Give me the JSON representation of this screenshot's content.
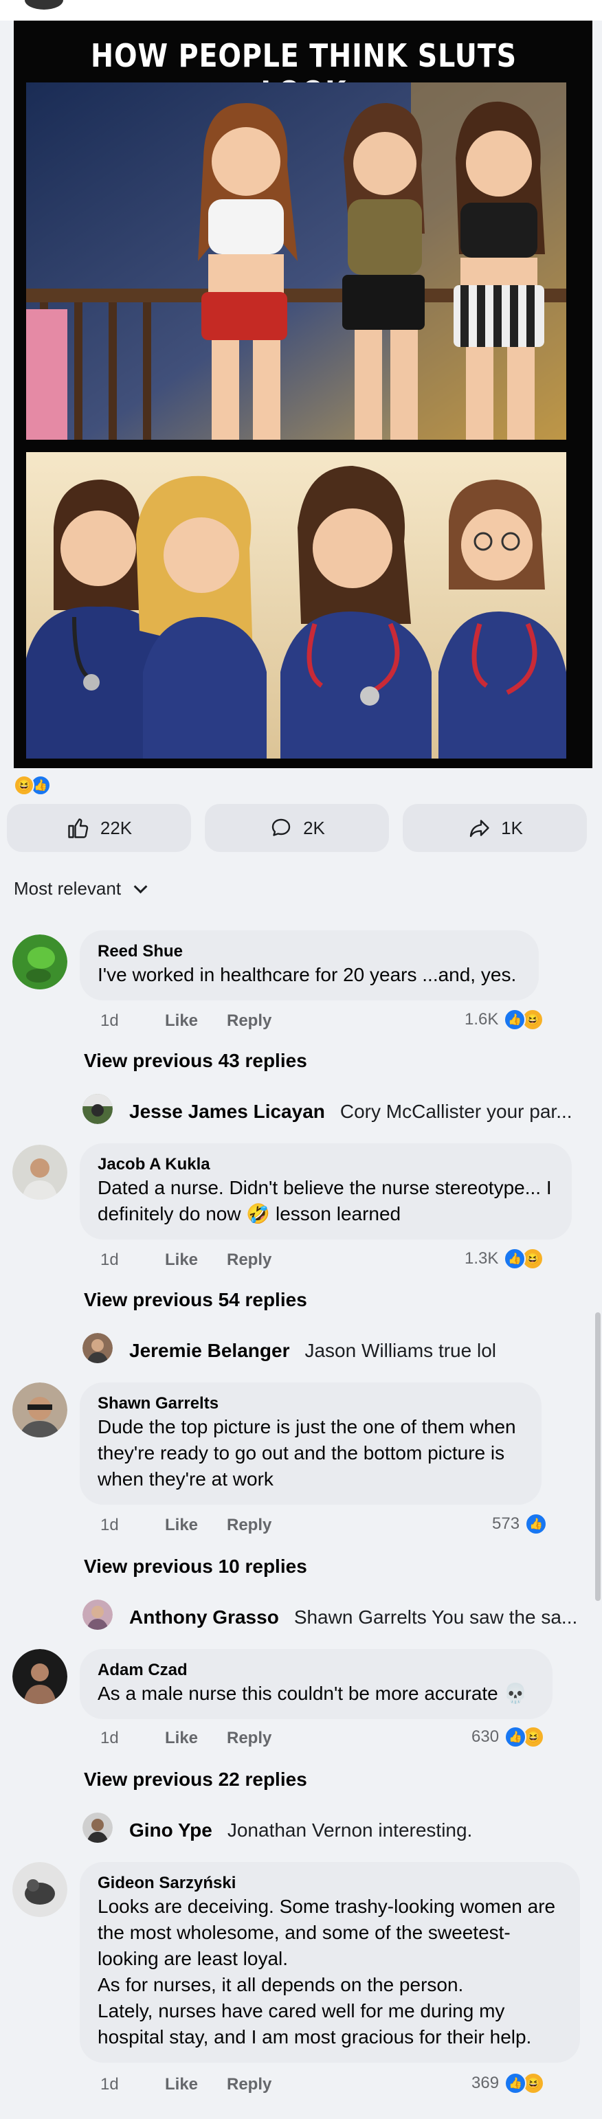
{
  "post": {
    "meme_title": "HOW PEOPLE THINK SLUTS LOOK",
    "reactions": [
      "haha",
      "like"
    ]
  },
  "actions": {
    "like_count": "22K",
    "comment_count": "2K",
    "share_count": "1K"
  },
  "sort": {
    "label": "Most relevant"
  },
  "comments": [
    {
      "author": "Reed Shue",
      "text": "I've worked in healthcare for 20 years ...and, yes.",
      "time": "1d",
      "like": "Like",
      "reply": "Reply",
      "reaction_count": "1.6K",
      "reactions": [
        "like",
        "haha"
      ],
      "view_previous": "View previous 43 replies",
      "reply_preview": {
        "author": "Jesse James Licayan",
        "text": "Cory McCallister your par..."
      }
    },
    {
      "author": "Jacob A Kukla",
      "text_line1": "Dated a nurse. Didn't believe the nurse stereotype... I",
      "text_line2": "definitely do now 🤣  lesson learned",
      "time": "1d",
      "like": "Like",
      "reply": "Reply",
      "reaction_count": "1.3K",
      "reactions": [
        "like",
        "haha"
      ],
      "view_previous": "View previous 54 replies",
      "reply_preview": {
        "author": "Jeremie Belanger",
        "text": "Jason Williams true lol"
      }
    },
    {
      "author": "Shawn Garrelts",
      "text_line1": "Dude the top picture is just the one of them when",
      "text_line2": "they're ready to go out and the bottom picture is",
      "text_line3": "when they're at work",
      "time": "1d",
      "like": "Like",
      "reply": "Reply",
      "reaction_count": "573",
      "reactions": [
        "like"
      ],
      "view_previous": "View previous 10 replies",
      "reply_preview": {
        "author": "Anthony Grasso",
        "text": "Shawn Garrelts You saw the sa..."
      }
    },
    {
      "author": "Adam Czad",
      "text": "As a male nurse this couldn't be more accurate 💀",
      "time": "1d",
      "like": "Like",
      "reply": "Reply",
      "reaction_count": "630",
      "reactions": [
        "like",
        "haha"
      ],
      "view_previous": "View previous 22 replies",
      "reply_preview": {
        "author": "Gino Ype",
        "text": "Jonathan Vernon interesting."
      }
    },
    {
      "author": "Gideon Sarzyński",
      "text_line1": "Looks are deceiving. Some trashy-looking women are",
      "text_line2": "the most wholesome, and some of the sweetest-",
      "text_line3": "looking are least loyal.",
      "text_line4": "As for nurses, it all depends on the person.",
      "text_line5": "Lately, nurses have cared well for me during my",
      "text_line6": "hospital stay, and I am most gracious for their help.",
      "time": "1d",
      "like": "Like",
      "reply": "Reply",
      "reaction_count": "369",
      "reactions": [
        "like",
        "haha"
      ]
    }
  ],
  "icons": {
    "like": "thumbs-up-icon",
    "comment": "speech-bubble-icon",
    "share": "share-arrow-icon",
    "haha": "laughing-face-icon"
  },
  "colors": {
    "like_blue": "#1877f2",
    "haha_yellow": "#f7b125",
    "bubble_bg": "#e9ebef",
    "page_bg": "#f0f2f5"
  }
}
